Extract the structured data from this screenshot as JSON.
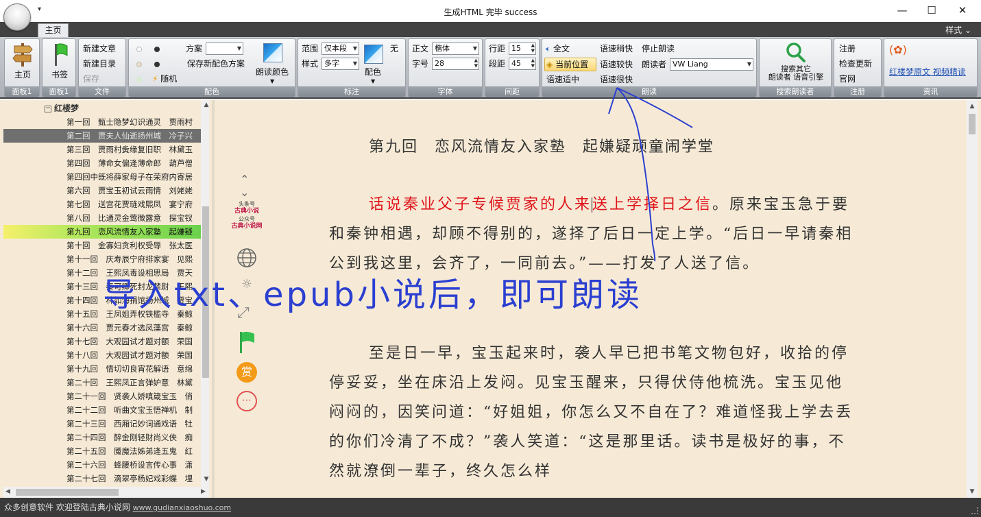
{
  "window": {
    "title": "生成HTML 完毕 success",
    "qat": "▾",
    "minimize": "—",
    "maximize": "☐",
    "close": "✕"
  },
  "tabs": {
    "home": "主页",
    "style_menu": "样式 ⌄"
  },
  "ribbon": {
    "panel1": {
      "home": "主页",
      "caption": "面板1"
    },
    "panel2": {
      "bookmark": "书签",
      "caption": "面板1"
    },
    "file": {
      "new_article": "新建文章",
      "new_catalog": "新建目录",
      "save": "保存",
      "caption": "文件"
    },
    "color": {
      "scheme_label": "方案",
      "scheme_value": "",
      "save_scheme": "保存新配色方案",
      "random": "随机",
      "read_color": "朗读颜色",
      "caption": "配色"
    },
    "annotate": {
      "range_label": "范围",
      "range_value": "仅本段",
      "style_label": "样式",
      "style_value": "多字",
      "none": "无",
      "color": "配色",
      "caption": "标注"
    },
    "font": {
      "body_label": "正文",
      "body_value": "楷体",
      "size_label": "字号",
      "size_value": "28",
      "caption": "字体"
    },
    "spacing": {
      "line_label": "行距",
      "line_value": "15",
      "para_label": "段距",
      "para_value": "45",
      "caption": "间距"
    },
    "read": {
      "full_text": "全文",
      "current_pos": "当前位置",
      "speed_normal": "语速适中",
      "speed_slightly_fast": "语速稍快",
      "speed_faster": "语速较快",
      "speed_very_fast": "语速很快",
      "stop": "停止朗读",
      "reader_label": "朗读者",
      "reader_value": "VW Liang",
      "caption": "朗读"
    },
    "search": {
      "line1": "搜索其它",
      "line2": "朗读者 语音引擎",
      "caption": "搜索朗读者"
    },
    "register": {
      "register": "注册",
      "check_update": "检查更新",
      "website": "官网",
      "caption": "注册"
    },
    "info": {
      "links": "红楼梦原文 视频精读",
      "caption": "资讯"
    }
  },
  "tree": {
    "book": "红楼梦",
    "chapters": [
      "第一回　甄士隐梦幻识通灵　贾雨村",
      "第二回　贾夫人仙逝扬州城　冷子兴",
      "第三回　贾雨村夤缘复旧职　林黛玉",
      "第四回　薄命女偏逢薄命郎　葫芦僧",
      "第四回中既将薛家母子在荣府内寄居",
      "第六回　贾宝玉初试云雨情　刘姥姥",
      "第七回　送宫花贾琏戏熙凤　宴宁府",
      "第八回　比通灵金莺微露意　探宝钗",
      "第九回　恋风流情友入家塾　起嫌疑",
      "第十回　金寡妇贪利权受辱　张太医",
      "第十一回　庆寿辰宁府排家宴　见熙",
      "第十二回　王熙凤毒设相思局　贾天",
      "第十三回　秦可卿死封龙禁尉　王熙",
      "第十四回　林如海捐馆扬州城　贾宝",
      "第十五回　王凤姐弄权铁槛寺　秦鲸",
      "第十六回　贾元春才选凤藻宫　秦鲸",
      "第十七回　大观园试才题对额　荣国",
      "第十八回　大观园试才题对额　荣国",
      "第十九回　情切切良宵花解语　意绵",
      "第二十回　王熙凤正言弹妒意　林黛",
      "第二十一回　贤袭人娇嗔箴宝玉　俏",
      "第二十二回　听曲文宝玉悟禅机　制",
      "第二十三回　西厢记妙词通戏语　牡",
      "第二十四回　醉金刚轻财尚义侠　痴",
      "第二十五回　魇魔法姊弟逢五鬼　红",
      "第二十六回　蜂腰桥设言传心事　潇",
      "第二十七回　滴翠亭杨妃戏彩蝶　埋"
    ],
    "selected_gray_index": 1,
    "selected_green_index": 8
  },
  "side_icons": {
    "watermark_line1": "头条号",
    "watermark_line2": "古典小说",
    "watermark_line3": "公众号",
    "watermark_line4": "古典小说网",
    "reward": "赏"
  },
  "reader": {
    "chapter_title": "第九回　恋风流情友入家塾　起嫌疑顽童闹学堂",
    "para1_highlight_a": "话说秦业父子专候贾家的人来",
    "para1_highlight_b": "送上学择日之信",
    "para1_rest": "。原来宝玉急于要和秦钟相遇，却顾不得别的，遂择了后日一定上学。“后日一早请秦相公到我这里，会齐了，一同前去。”——打发了人送了信。",
    "para2": "至是日一早，宝玉起来时，袭人早已把书笔文物包好，收拾的停停妥妥，坐在床沿上发闷。见宝玉醒来，只得伏侍他梳洗。宝玉见他闷闷的，因笑问道：“好姐姐，你怎么又不自在了？难道怪我上学去丢的你们冷清了不成？”袭人笑道：“这是那里话。读书是极好的事，不然就潦倒一辈子，终久怎么样"
  },
  "overlay_text": "导入txt、epub小说后，即可朗读",
  "status": {
    "text": "众多创意软件 欢迎登陆古典小说网",
    "url": "www.gudianxiaoshuo.com"
  },
  "colors": {
    "highlight": "#e0141b",
    "overlay": "#2b3fd0",
    "background": "#f6ead6"
  }
}
